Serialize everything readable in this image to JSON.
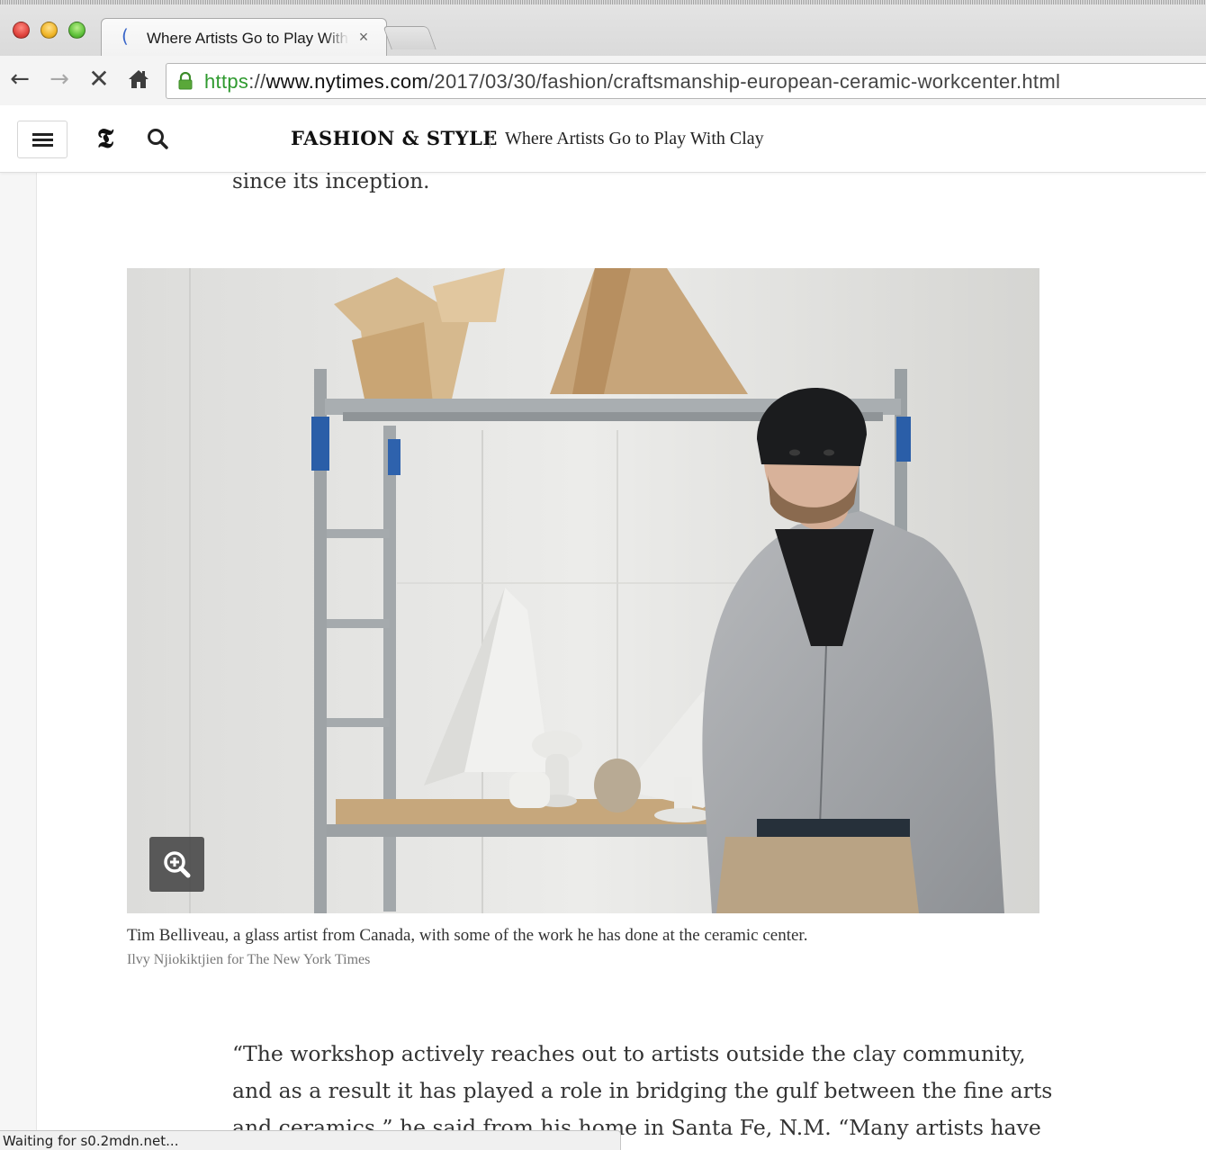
{
  "browser": {
    "tab_title": "Where Artists Go to Play With Clay",
    "tab_close": "×",
    "url_scheme": "https",
    "url_separator": "://",
    "url_host": "www.nytimes.com",
    "url_path": "/2017/03/30/fashion/craftsmanship-european-ceramic-workcenter.html",
    "status_text": "Waiting for s0.2mdn.net..."
  },
  "header": {
    "section": "FASHION & STYLE",
    "headline": "Where Artists Go to Play With Clay",
    "logo_glyph": "𝕿"
  },
  "article": {
    "intro_tail": "since its inception.",
    "photo_caption": "Tim Belliveau, a glass artist from Canada, with some of the work he has done at the ceramic center.",
    "photo_credit": "Ilvy Njiokiktjien for The New York Times",
    "body_lines": [
      "“The workshop actively reaches out to artists outside the clay community,",
      "and as a result it has played a role in bridging the gulf between the fine arts",
      "and ceramics,” he said from his home in Santa Fe, N.M. “Many artists have"
    ]
  },
  "icons": {
    "back": "arrow-left-icon",
    "forward": "arrow-right-icon",
    "stop": "stop-icon",
    "home": "home-icon",
    "lock": "lock-icon",
    "menu": "hamburger-menu-icon",
    "search": "search-icon",
    "zoom": "zoom-in-icon"
  },
  "colors": {
    "secure_green": "#2f9a2f",
    "spinner_blue": "#3a66c9",
    "body_text": "#333333"
  }
}
